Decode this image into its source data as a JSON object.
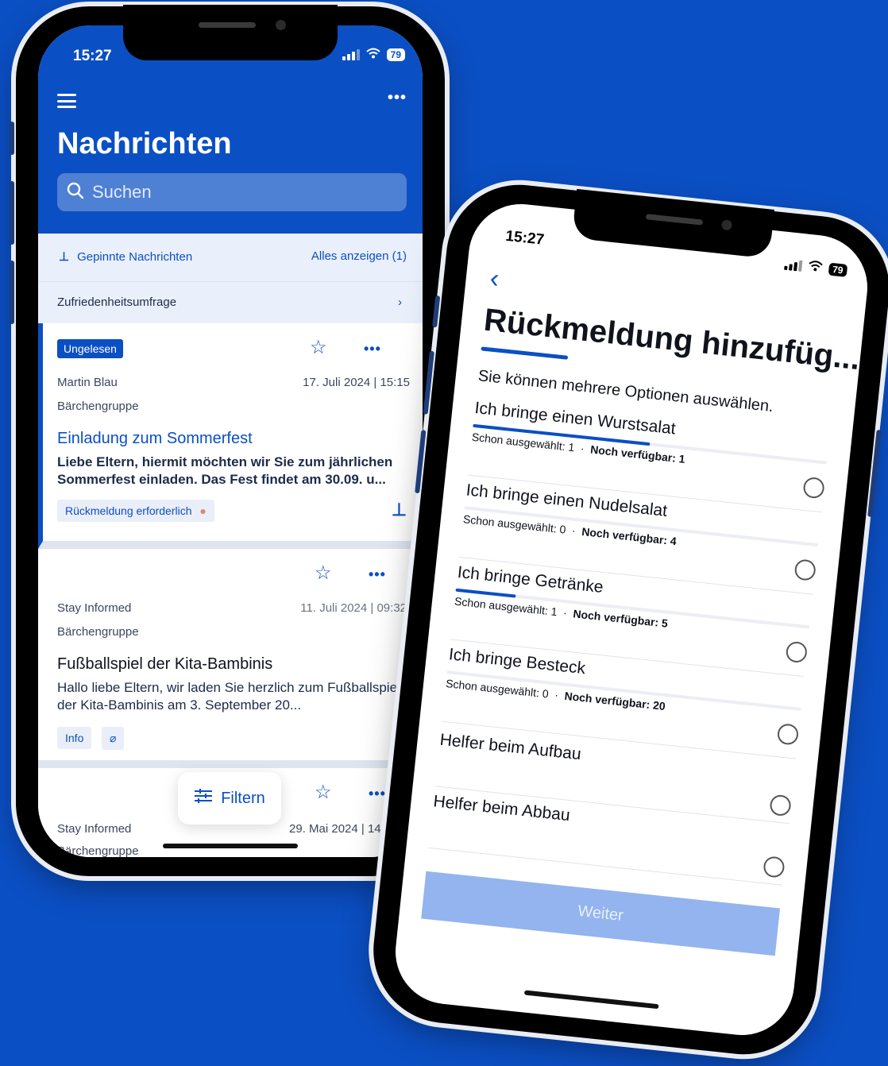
{
  "colors": {
    "brand": "#0b4fc4",
    "background": "#0b4fc4",
    "button_disabled": "#93b4ee"
  },
  "phone1": {
    "status_time": "15:27",
    "battery": "79",
    "title": "Nachrichten",
    "search_placeholder": "Suchen",
    "pinned": {
      "label": "Gepinnte Nachrichten",
      "show_all": "Alles anzeigen (1)"
    },
    "survey_row": "Zufriedenheitsumfrage",
    "messages": [
      {
        "badge": "Ungelesen",
        "sender": "Martin Blau",
        "group": "Bärchengruppe",
        "date": "17. Juli 2024 | 15:15",
        "title": "Einladung zum Sommerfest",
        "body": "Liebe Eltern, hiermit möchten wir Sie zum jährlichen Sommerfest einladen. Das Fest findet am 30.09. u...",
        "tag": "Rückmeldung erforderlich"
      },
      {
        "sender": "Stay Informed",
        "group": "Bärchengruppe",
        "date": "11. Juli 2024 | 09:32",
        "title": "Fußballspiel der Kita-Bambinis",
        "body": "Hallo liebe Eltern, wir laden Sie herzlich zum Fußballspiel der Kita-Bambinis am 3. September 20...",
        "tag": "Info"
      },
      {
        "sender": "Stay Informed",
        "group": "Bärchengruppe",
        "date": "29. Mai 2024 | 14"
      }
    ],
    "filter_label": "Filtern"
  },
  "phone2": {
    "status_time": "15:27",
    "battery": "79",
    "title": "Rückmeldung hinzufüg...",
    "subtitle": "Sie können mehrere Optionen auswählen.",
    "options": [
      {
        "label": "Ich bringe einen Wurstsalat",
        "selected_label": "Schon ausgewählt:",
        "selected": "1",
        "available_label": "Noch verfügbar:",
        "available": "1",
        "fill": 0.5
      },
      {
        "label": "Ich bringe einen Nudelsalat",
        "selected_label": "Schon ausgewählt:",
        "selected": "0",
        "available_label": "Noch verfügbar:",
        "available": "4",
        "fill": 0.0
      },
      {
        "label": "Ich bringe Getränke",
        "selected_label": "Schon ausgewählt:",
        "selected": "1",
        "available_label": "Noch verfügbar:",
        "available": "5",
        "fill": 0.17
      },
      {
        "label": "Ich bringe Besteck",
        "selected_label": "Schon ausgewählt:",
        "selected": "0",
        "available_label": "Noch verfügbar:",
        "available": "20",
        "fill": 0.0
      },
      {
        "label": "Helfer beim Aufbau"
      },
      {
        "label": "Helfer beim Abbau"
      }
    ],
    "button_label": "Weiter"
  }
}
